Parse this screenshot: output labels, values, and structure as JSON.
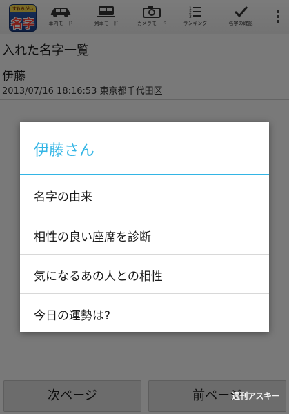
{
  "app": {
    "icon_small_text": "すれちがい",
    "icon_big_text": "名字",
    "icon_name": "app-logo-icon"
  },
  "actionbar": {
    "items": [
      {
        "label": "車内モード",
        "icon": "car-icon"
      },
      {
        "label": "列車モード",
        "icon": "train-icon"
      },
      {
        "label": "カメラモード",
        "icon": "camera-icon"
      },
      {
        "label": "ランキング",
        "icon": "ranking-list-icon"
      },
      {
        "label": "名字の確認",
        "icon": "checkmark-icon"
      }
    ],
    "overflow_icon": "overflow-menu-icon"
  },
  "main": {
    "section_title": "入れた名字一覧",
    "entry": {
      "name": "伊藤",
      "meta": "2013/07/16 18:16:53 東京都千代田区"
    }
  },
  "dialog": {
    "title": "伊藤さん",
    "items": [
      "名字の由来",
      "相性の良い座席を診断",
      "気になるあの人との相性",
      "今日の運勢は?"
    ]
  },
  "bottom": {
    "next_label": "次ページ",
    "prev_label": "前ページ"
  },
  "watermark": "週刊アスキー",
  "colors": {
    "accent": "#33b5e5",
    "dim_overlay": "rgba(0,0,0,0.5)",
    "dialog_bg": "#ffffff",
    "app_icon_blue": "#2f5fb5",
    "app_icon_text": "#ff3b30"
  }
}
